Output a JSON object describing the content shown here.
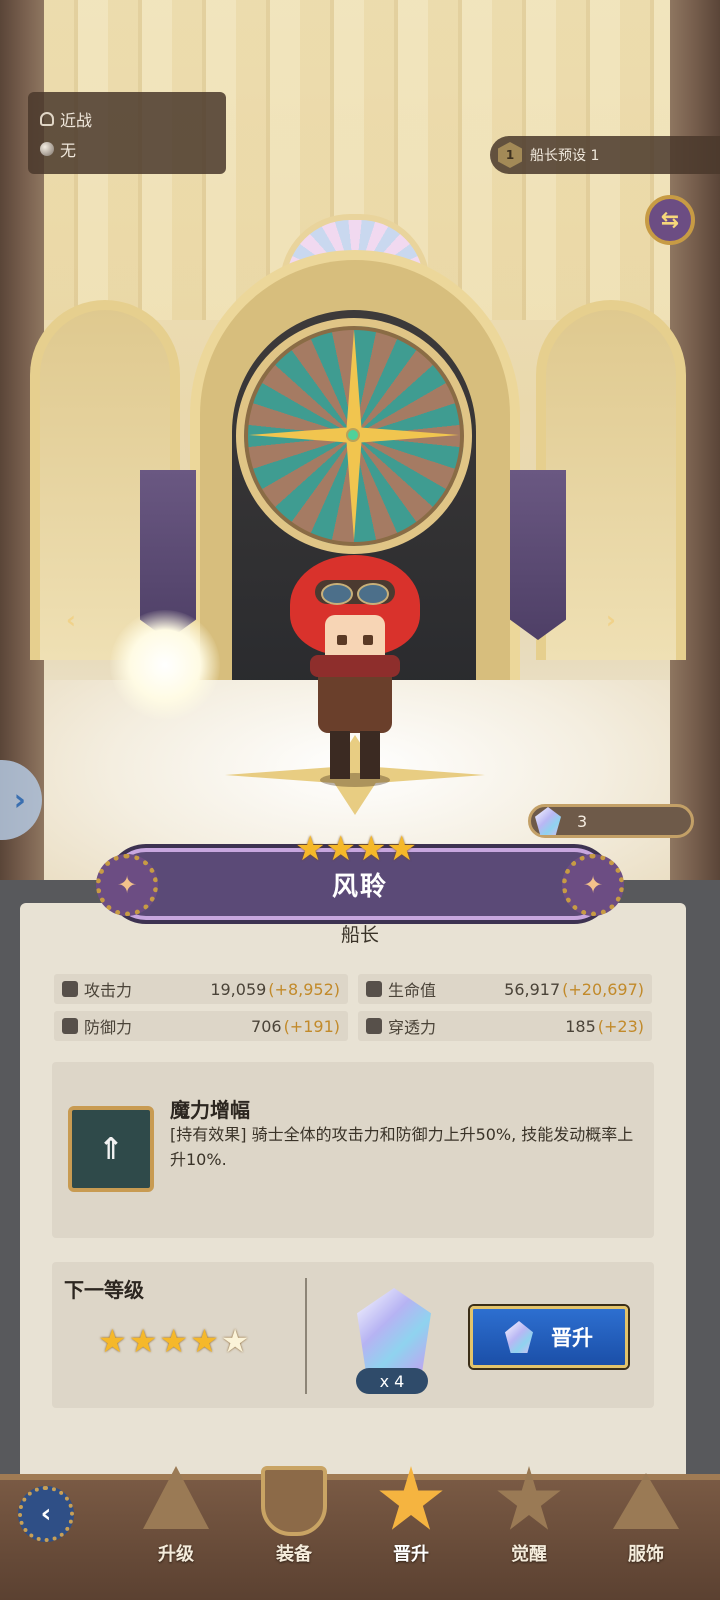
{
  "hero_info": {
    "attack_type": "近战",
    "element": "无"
  },
  "preset": {
    "number": "1",
    "label": "船长预设 1"
  },
  "shards": {
    "count": "3"
  },
  "hero": {
    "name": "风聆",
    "role": "船长",
    "current_stars": 4,
    "star_glyphs": [
      "★",
      "★",
      "★",
      "★"
    ]
  },
  "stats": {
    "attack": {
      "label": "攻击力",
      "value": "19,059",
      "bonus": "(+8,952)"
    },
    "hp": {
      "label": "生命值",
      "value": "56,917",
      "bonus": "(+20,697)"
    },
    "defense": {
      "label": "防御力",
      "value": "706",
      "bonus": "(+191)"
    },
    "penetration": {
      "label": "穿透力",
      "value": "185",
      "bonus": "(+23)"
    }
  },
  "skill": {
    "title": "魔力增幅",
    "description": "[持有效果] 骑士全体的攻击力和防御力上升50%, 技能发动概率上升10%."
  },
  "next_level": {
    "title": "下一等级",
    "stars_filled": 4,
    "stars_total": 5,
    "cost": "x 4",
    "button_label": "晋升"
  },
  "nav": {
    "items": [
      {
        "label": "升级"
      },
      {
        "label": "装备"
      },
      {
        "label": "晋升"
      },
      {
        "label": "觉醒"
      },
      {
        "label": "服饰"
      }
    ],
    "active": "晋升"
  },
  "icons": {
    "back": "‹",
    "swap": "⇆",
    "arrow_left": "‹",
    "arrow_right": "›",
    "side_tab": "›",
    "star": "★",
    "compass": "✦"
  },
  "colors": {
    "accent_gold": "#f5b82a",
    "bonus_text": "#c28a2a",
    "button_blue": "#2d6fd0",
    "name_plate": "#5b4a77"
  }
}
